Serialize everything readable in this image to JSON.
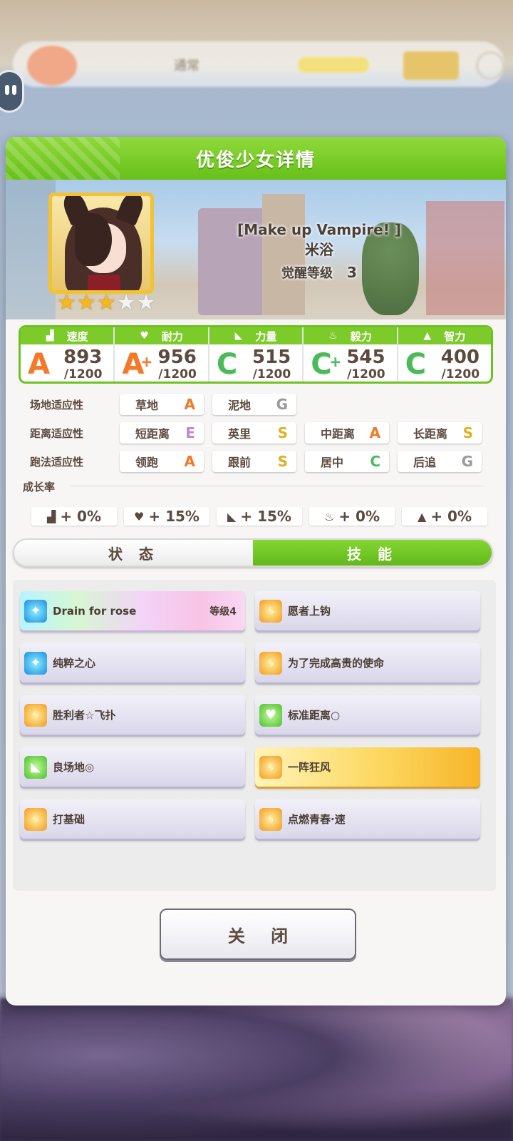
{
  "background": {
    "top_title": "通常"
  },
  "dialog": {
    "title": "优俊少女详情",
    "close_label": "关 闭"
  },
  "card": {
    "subtitle": "[Make up Vampire! ]",
    "name": "米浴",
    "awakening_label": "觉醒等级",
    "awakening_level": "3",
    "stars": {
      "filled": 3,
      "total": 5
    }
  },
  "stats": [
    {
      "icon": "speed-icon",
      "label": "速度",
      "grade": "A",
      "plus": "",
      "value": "893",
      "max": "/1200"
    },
    {
      "icon": "heart-icon",
      "label": "耐力",
      "grade": "A",
      "plus": "+",
      "value": "956",
      "max": "/1200"
    },
    {
      "icon": "power-icon",
      "label": "力量",
      "grade": "C",
      "plus": "",
      "value": "515",
      "max": "/1200"
    },
    {
      "icon": "flame-icon",
      "label": "毅力",
      "grade": "C",
      "plus": "+",
      "value": "545",
      "max": "/1200"
    },
    {
      "icon": "mortarboard-icon",
      "label": "智力",
      "grade": "C",
      "plus": "",
      "value": "400",
      "max": "/1200"
    }
  ],
  "aptitude": {
    "track": {
      "label": "场地适应性",
      "items": [
        {
          "name": "草地",
          "grade": "A"
        },
        {
          "name": "泥地",
          "grade": "G"
        }
      ]
    },
    "distance": {
      "label": "距离适应性",
      "items": [
        {
          "name": "短距离",
          "grade": "E"
        },
        {
          "name": "英里",
          "grade": "S"
        },
        {
          "name": "中距离",
          "grade": "A"
        },
        {
          "name": "长距离",
          "grade": "S"
        }
      ]
    },
    "style": {
      "label": "跑法适应性",
      "items": [
        {
          "name": "领跑",
          "grade": "A"
        },
        {
          "name": "跟前",
          "grade": "S"
        },
        {
          "name": "居中",
          "grade": "C"
        },
        {
          "name": "后追",
          "grade": "G"
        }
      ]
    }
  },
  "growth": {
    "label": "成长率",
    "items": [
      {
        "icon": "speed-icon",
        "value": "+ 0%"
      },
      {
        "icon": "heart-icon",
        "value": "+ 15%"
      },
      {
        "icon": "power-icon",
        "value": "+ 15%"
      },
      {
        "icon": "flame-icon",
        "value": "+ 0%"
      },
      {
        "icon": "mortarboard-icon",
        "value": "+ 0%"
      }
    ]
  },
  "tabs": {
    "status": "状 态",
    "skills": "技 能",
    "active": "skills"
  },
  "skills": [
    {
      "name": "Drain for rose",
      "level": "等级4",
      "icon": "sparkle-icon",
      "style": "rainbow"
    },
    {
      "name": "愿者上钩",
      "level": "",
      "icon": "runner-icon",
      "style": "normal"
    },
    {
      "name": "纯粹之心",
      "level": "",
      "icon": "sparkle-icon",
      "style": "normal"
    },
    {
      "name": "为了完成高贵的使命",
      "level": "",
      "icon": "runner-icon",
      "style": "normal"
    },
    {
      "name": "胜利者☆飞扑",
      "level": "",
      "icon": "runner-icon",
      "style": "normal"
    },
    {
      "name": "标准距离○",
      "level": "",
      "icon": "heart-icon",
      "style": "normal"
    },
    {
      "name": "良场地◎",
      "level": "",
      "icon": "power-icon",
      "style": "normal"
    },
    {
      "name": "一阵狂风",
      "level": "",
      "icon": "runner-icon",
      "style": "gold"
    },
    {
      "name": "打基础",
      "level": "",
      "icon": "runner-icon",
      "style": "normal"
    },
    {
      "name": "点燃青春·速",
      "level": "",
      "icon": "runner-icon",
      "style": "normal"
    }
  ]
}
